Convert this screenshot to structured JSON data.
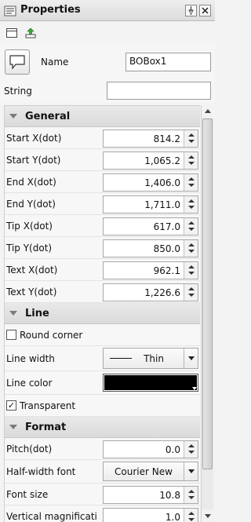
{
  "panel": {
    "title": "Properties",
    "pin_icon": "pin-icon",
    "close_icon": "close-icon"
  },
  "toolbar": {
    "items": [
      "window-icon",
      "up-arrow-icon"
    ]
  },
  "header": {
    "name_label": "Name",
    "name_value": "BOBox1",
    "string_label": "String",
    "string_value": ""
  },
  "general": {
    "label": "General",
    "rows": [
      {
        "label": "Start X(dot)",
        "value": "814.2"
      },
      {
        "label": "Start Y(dot)",
        "value": "1,065.2"
      },
      {
        "label": "End X(dot)",
        "value": "1,406.0"
      },
      {
        "label": "End Y(dot)",
        "value": "1,711.0"
      },
      {
        "label": "Tip X(dot)",
        "value": "617.0"
      },
      {
        "label": "Tip Y(dot)",
        "value": "850.0"
      },
      {
        "label": "Text X(dot)",
        "value": "962.1"
      },
      {
        "label": "Text Y(dot)",
        "value": "1,226.6"
      }
    ]
  },
  "line": {
    "label": "Line",
    "round_corner_label": "Round corner",
    "round_corner_checked": false,
    "width_label": "Line width",
    "width_value": "Thin",
    "color_label": "Line color",
    "color_value": "#000000",
    "transparent_label": "Transparent",
    "transparent_checked": true,
    "check_mark": "✓"
  },
  "format": {
    "label": "Format",
    "pitch_label": "Pitch(dot)",
    "pitch_value": "0.0",
    "font_label": "Half-width font",
    "font_value": "Courier New",
    "size_label": "Font size",
    "size_value": "10.8",
    "vmag_label": "Vertical magnificati",
    "vmag_value": "1.0"
  }
}
